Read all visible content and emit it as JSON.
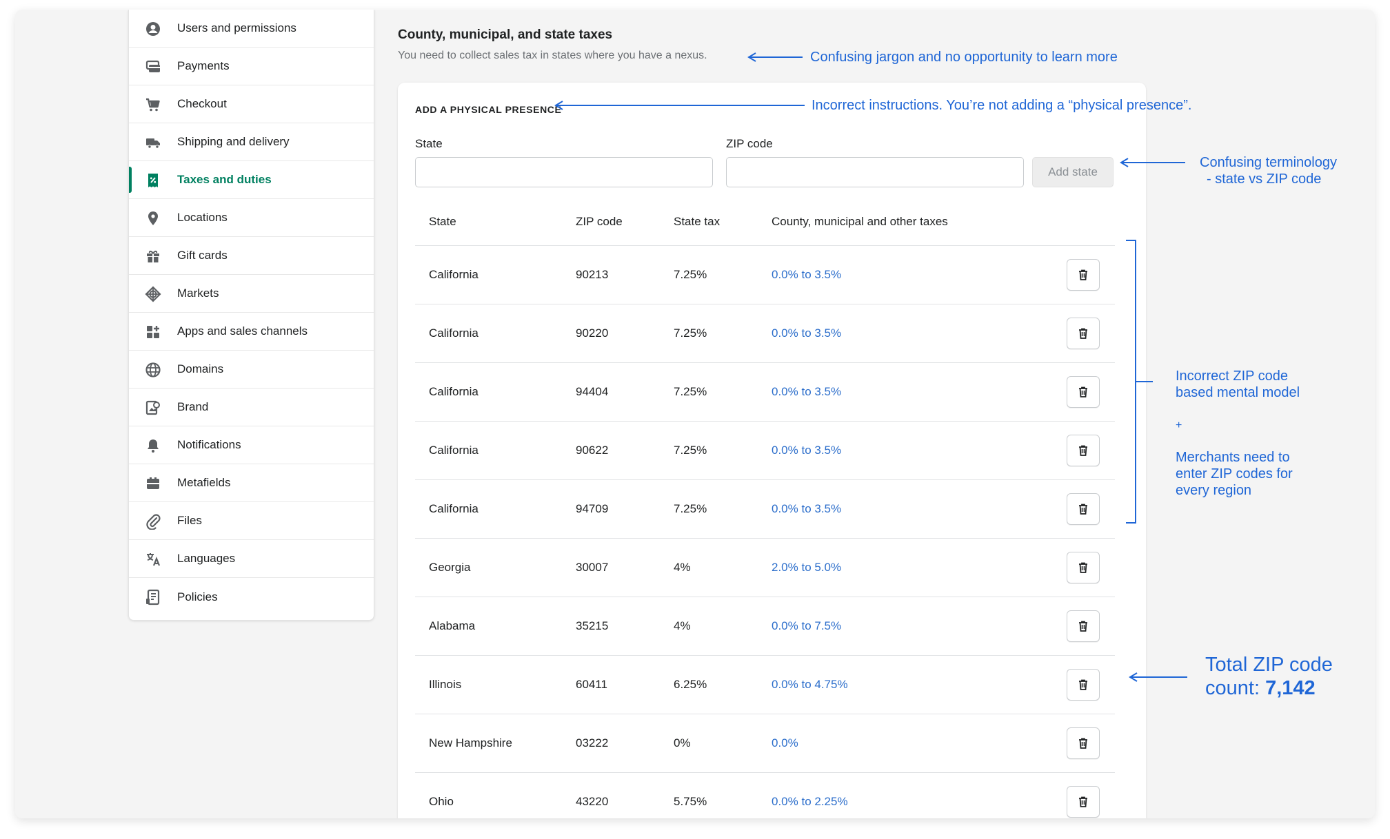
{
  "sidebar": {
    "items": [
      {
        "label": "Users and permissions",
        "icon": "user-circle-icon"
      },
      {
        "label": "Payments",
        "icon": "credit-card-icon"
      },
      {
        "label": "Checkout",
        "icon": "cart-icon"
      },
      {
        "label": "Shipping and delivery",
        "icon": "truck-icon"
      },
      {
        "label": "Taxes and duties",
        "icon": "receipt-percent-icon",
        "active": true
      },
      {
        "label": "Locations",
        "icon": "map-pin-icon"
      },
      {
        "label": "Gift cards",
        "icon": "gift-icon"
      },
      {
        "label": "Markets",
        "icon": "globe-markets-icon"
      },
      {
        "label": "Apps and sales channels",
        "icon": "apps-grid-icon"
      },
      {
        "label": "Domains",
        "icon": "globe-icon"
      },
      {
        "label": "Brand",
        "icon": "brand-icon"
      },
      {
        "label": "Notifications",
        "icon": "bell-icon"
      },
      {
        "label": "Metafields",
        "icon": "metafields-icon"
      },
      {
        "label": "Files",
        "icon": "paperclip-icon"
      },
      {
        "label": "Languages",
        "icon": "translate-icon"
      },
      {
        "label": "Policies",
        "icon": "document-icon"
      }
    ]
  },
  "section": {
    "title": "County, municipal, and state taxes",
    "subtitle": "You need to collect sales tax in states where you have a nexus."
  },
  "form": {
    "heading": "ADD A PHYSICAL PRESENCE",
    "state_label": "State",
    "zip_label": "ZIP code",
    "state_value": "",
    "zip_value": "",
    "add_button": "Add state"
  },
  "table": {
    "headers": [
      "State",
      "ZIP code",
      "State tax",
      "County, municipal and other taxes"
    ],
    "rows": [
      {
        "state": "California",
        "zip": "90213",
        "state_tax": "7.25%",
        "other": "0.0% to 3.5%"
      },
      {
        "state": "California",
        "zip": "90220",
        "state_tax": "7.25%",
        "other": "0.0% to 3.5%"
      },
      {
        "state": "California",
        "zip": "94404",
        "state_tax": "7.25%",
        "other": "0.0% to 3.5%"
      },
      {
        "state": "California",
        "zip": "90622",
        "state_tax": "7.25%",
        "other": "0.0% to 3.5%"
      },
      {
        "state": "California",
        "zip": "94709",
        "state_tax": "7.25%",
        "other": "0.0% to 3.5%"
      },
      {
        "state": "Georgia",
        "zip": "30007",
        "state_tax": "4%",
        "other": "2.0% to 5.0%"
      },
      {
        "state": "Alabama",
        "zip": "35215",
        "state_tax": "4%",
        "other": "0.0% to 7.5%"
      },
      {
        "state": "Illinois",
        "zip": "60411",
        "state_tax": "6.25%",
        "other": "0.0% to 4.75%"
      },
      {
        "state": "New Hampshire",
        "zip": "03222",
        "state_tax": "0%",
        "other": "0.0%"
      },
      {
        "state": "Ohio",
        "zip": "43220",
        "state_tax": "5.75%",
        "other": "0.0% to 2.25%"
      }
    ]
  },
  "annotations": {
    "jargon": "Confusing jargon and no opportunity to learn more",
    "instructions": "Incorrect instructions. You’re not adding a “physical presence”.",
    "terminology_1": "Confusing terminology",
    "terminology_2": "- state vs ZIP code",
    "mental_1": "Incorrect ZIP code",
    "mental_2": "based mental model",
    "plus": "+",
    "merchants_1": "Merchants need to",
    "merchants_2": "enter ZIP codes for",
    "merchants_3": "every region",
    "total_1": "Total ZIP code",
    "total_2": "count: ",
    "total_count": "7,142"
  },
  "colors": {
    "accent_green": "#008060",
    "link_blue": "#2c6ecb",
    "annotation_blue": "#1f66d6"
  }
}
